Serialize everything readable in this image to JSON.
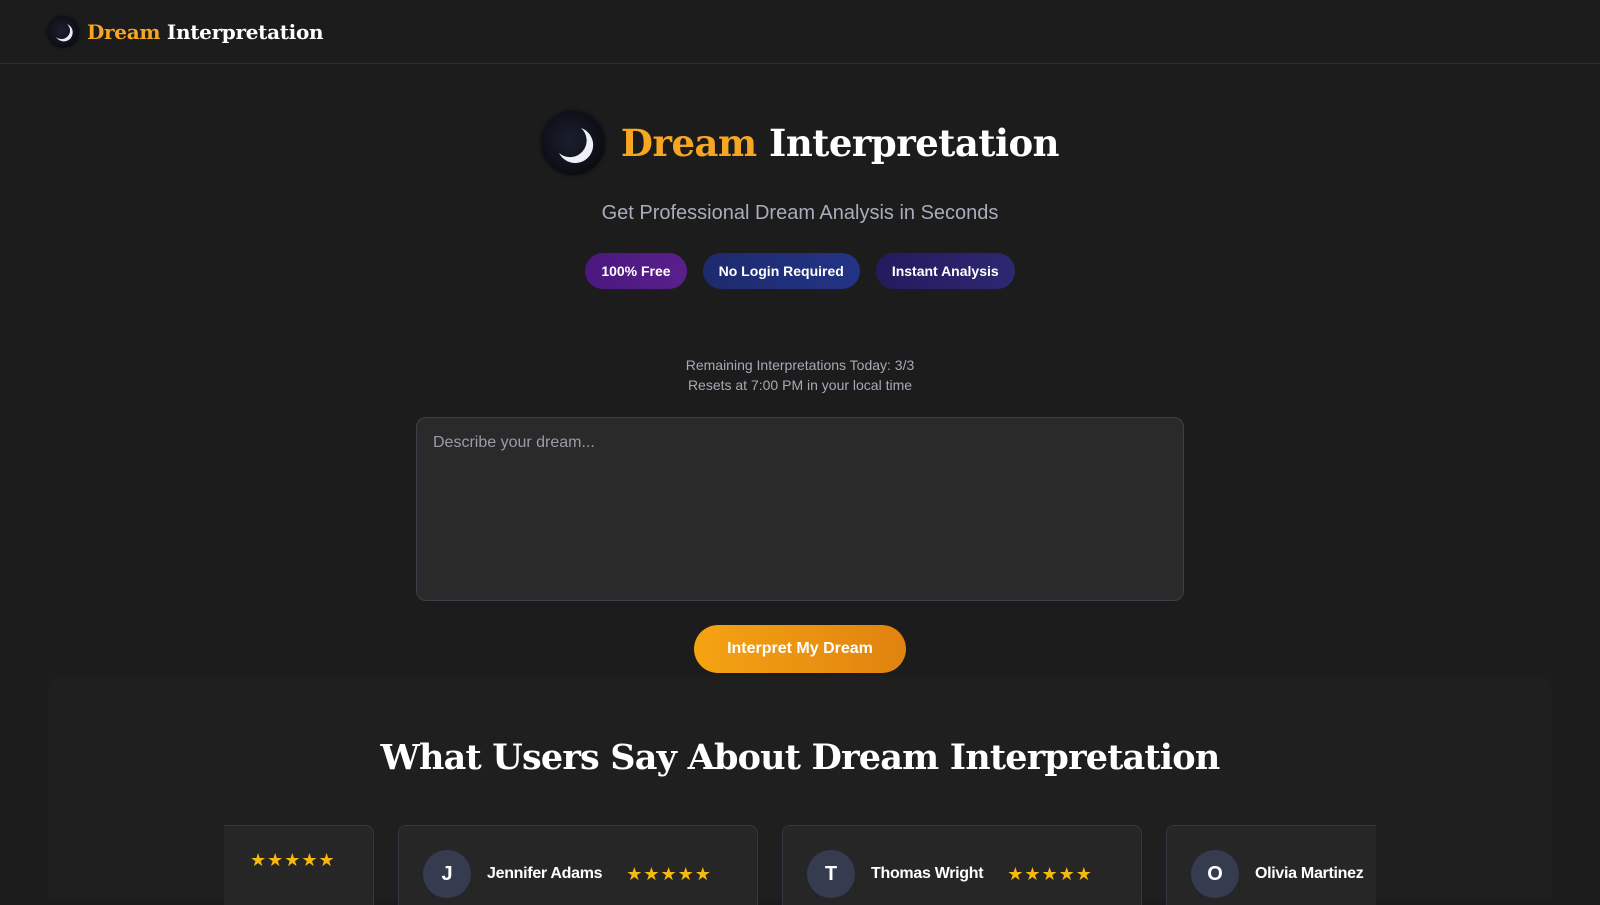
{
  "header": {
    "brand_accent": "Dream",
    "brand_rest": "Interpretation",
    "logo_icon": "crescent-moon-icon"
  },
  "hero": {
    "title_accent": "Dream",
    "title_rest": "Interpretation",
    "subtitle": "Get Professional Dream Analysis in Seconds",
    "badges": [
      {
        "label": "100% Free"
      },
      {
        "label": "No Login Required"
      },
      {
        "label": "Instant Analysis"
      }
    ]
  },
  "quota": {
    "remaining": "Remaining Interpretations Today: 3/3",
    "resets": "Resets at 7:00 PM in your local time"
  },
  "dream_input": {
    "value": "",
    "placeholder": "Describe your dream..."
  },
  "interpret_button": {
    "label": "Interpret My Dream"
  },
  "testimonials": {
    "title": "What Users Say About Dream Interpretation",
    "cards": [
      {
        "initial": "",
        "name": "",
        "stars": "★★★★★"
      },
      {
        "initial": "J",
        "name": "Jennifer Adams",
        "stars": "★★★★★"
      },
      {
        "initial": "T",
        "name": "Thomas Wright",
        "stars": "★★★★★"
      },
      {
        "initial": "O",
        "name": "Olivia Martinez",
        "stars": ""
      }
    ]
  },
  "colors": {
    "background": "#1c1c1c",
    "accent": "#f5a623",
    "button_gradient_start": "#f5a312",
    "button_gradient_end": "#e08310",
    "star": "#f5b90f"
  }
}
